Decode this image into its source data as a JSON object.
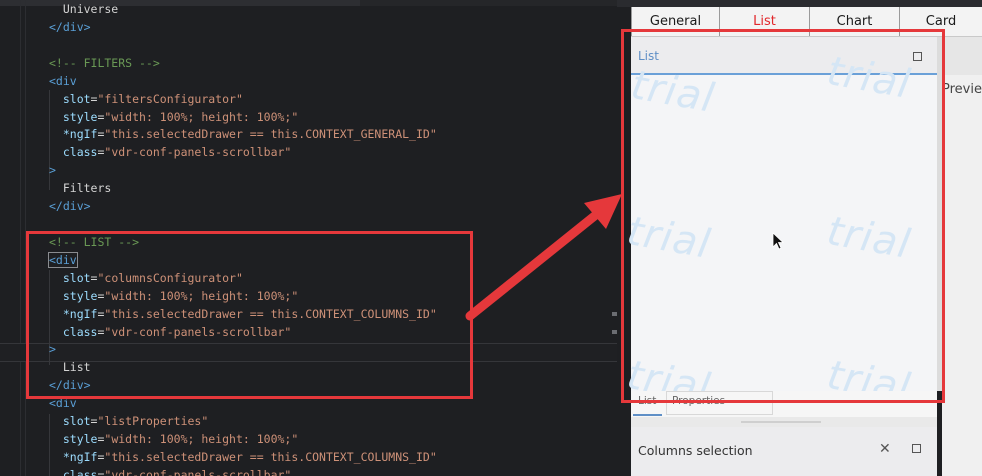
{
  "editor": {
    "lines": [
      [
        {
          "t": "  Universe",
          "c": "c-text"
        }
      ],
      [
        {
          "t": "</div>",
          "c": "c-tag"
        }
      ],
      [],
      [
        {
          "t": "<!-- FILTERS -->",
          "c": "c-comment"
        }
      ],
      [
        {
          "t": "<div",
          "c": "c-tag"
        }
      ],
      [
        {
          "t": "  slot",
          "c": "c-attr"
        },
        {
          "t": "=",
          "c": "c-text"
        },
        {
          "t": "\"filtersConfigurator\"",
          "c": "c-str"
        }
      ],
      [
        {
          "t": "  style",
          "c": "c-attr"
        },
        {
          "t": "=",
          "c": "c-text"
        },
        {
          "t": "\"width: 100%; height: 100%;\"",
          "c": "c-str"
        }
      ],
      [
        {
          "t": "  *ngIf",
          "c": "c-attr"
        },
        {
          "t": "=",
          "c": "c-text"
        },
        {
          "t": "\"this.selectedDrawer == this.CONTEXT_GENERAL_ID\"",
          "c": "c-str"
        }
      ],
      [
        {
          "t": "  class",
          "c": "c-attr"
        },
        {
          "t": "=",
          "c": "c-text"
        },
        {
          "t": "\"vdr-conf-panels-scrollbar\"",
          "c": "c-str"
        }
      ],
      [
        {
          "t": ">",
          "c": "c-tag"
        }
      ],
      [
        {
          "t": "  Filters",
          "c": "c-text"
        }
      ],
      [
        {
          "t": "</div>",
          "c": "c-tag"
        }
      ],
      [],
      [
        {
          "t": "<!-- LIST -->",
          "c": "c-comment"
        }
      ],
      [
        {
          "t": "<div",
          "c": "c-tag"
        }
      ],
      [
        {
          "t": "  slot",
          "c": "c-attr"
        },
        {
          "t": "=",
          "c": "c-text"
        },
        {
          "t": "\"columnsConfigurator\"",
          "c": "c-str"
        }
      ],
      [
        {
          "t": "  style",
          "c": "c-attr"
        },
        {
          "t": "=",
          "c": "c-text"
        },
        {
          "t": "\"width: 100%; height: 100%;\"",
          "c": "c-str"
        }
      ],
      [
        {
          "t": "  *ngIf",
          "c": "c-attr"
        },
        {
          "t": "=",
          "c": "c-text"
        },
        {
          "t": "\"this.selectedDrawer == this.CONTEXT_COLUMNS_ID\"",
          "c": "c-str"
        }
      ],
      [
        {
          "t": "  class",
          "c": "c-attr"
        },
        {
          "t": "=",
          "c": "c-text"
        },
        {
          "t": "\"vdr-conf-panels-scrollbar\"",
          "c": "c-str"
        }
      ],
      [
        {
          "t": ">",
          "c": "c-tag"
        }
      ],
      [
        {
          "t": "  List",
          "c": "c-text"
        }
      ],
      [
        {
          "t": "</div>",
          "c": "c-tag"
        }
      ],
      [
        {
          "t": "<div",
          "c": "c-tag"
        }
      ],
      [
        {
          "t": "  slot",
          "c": "c-attr"
        },
        {
          "t": "=",
          "c": "c-text"
        },
        {
          "t": "\"listProperties\"",
          "c": "c-str"
        }
      ],
      [
        {
          "t": "  style",
          "c": "c-attr"
        },
        {
          "t": "=",
          "c": "c-text"
        },
        {
          "t": "\"width: 100%; height: 100%;\"",
          "c": "c-str"
        }
      ],
      [
        {
          "t": "  *ngIf",
          "c": "c-attr"
        },
        {
          "t": "=",
          "c": "c-text"
        },
        {
          "t": "\"this.selectedDrawer == this.CONTEXT_COLUMNS_ID\"",
          "c": "c-str"
        }
      ],
      [
        {
          "t": "  class",
          "c": "c-attr"
        },
        {
          "t": "=",
          "c": "c-text"
        },
        {
          "t": "\"vdr-conf-panels-scrollbar\"",
          "c": "c-str"
        }
      ]
    ]
  },
  "tabs": [
    {
      "label": "General",
      "active": false
    },
    {
      "label": "List",
      "active": true
    },
    {
      "label": "Chart",
      "active": false
    },
    {
      "label": "Card",
      "active": false
    }
  ],
  "list_panel": {
    "title": "List",
    "watermark": "trial"
  },
  "preview_label": "Previe",
  "subtabs": {
    "list": "List",
    "properties": "Properties"
  },
  "columns_panel": {
    "title": "Columns selection"
  },
  "icons": {
    "pin": "pin-icon",
    "maximize": "maximize-icon",
    "cursor": "mouse-cursor-icon"
  },
  "colors": {
    "annotation": "#e5383b",
    "active_tab": "#e2262a",
    "panel_accent": "#6aa0d8"
  }
}
